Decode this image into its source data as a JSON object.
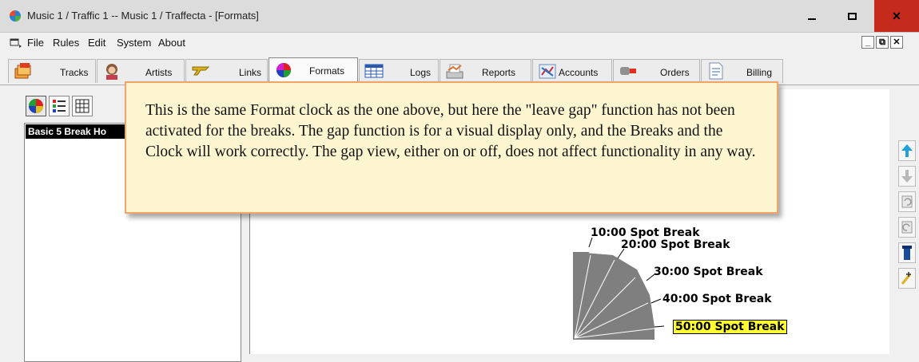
{
  "window": {
    "title": "Music 1 / Traffic 1 -- Music 1 / Traffecta - [Formats]",
    "icon": "app-globe-icon"
  },
  "menu": {
    "items": [
      "File",
      "Rules",
      "Edit",
      "System",
      "About"
    ]
  },
  "toolbar": {
    "tabs": [
      {
        "label": "Tracks",
        "icon": "tracks-icon",
        "active": false
      },
      {
        "label": "Artists",
        "icon": "artists-icon",
        "active": false
      },
      {
        "label": "Links",
        "icon": "links-icon",
        "active": false
      },
      {
        "label": "Formats",
        "icon": "formats-clock-icon",
        "active": true
      },
      {
        "label": "Logs",
        "icon": "logs-icon",
        "active": false
      },
      {
        "label": "Reports",
        "icon": "reports-icon",
        "active": false
      },
      {
        "label": "Accounts",
        "icon": "accounts-icon",
        "active": false
      },
      {
        "label": "Orders",
        "icon": "orders-icon",
        "active": false
      },
      {
        "label": "Billing",
        "icon": "billing-icon",
        "active": false
      }
    ]
  },
  "left_panel": {
    "view_buttons": [
      "clock-view-icon",
      "list-view-icon",
      "grid-view-icon"
    ],
    "formats": [
      "Basic 5 Break Ho"
    ]
  },
  "callout": {
    "text": "This is the same Format clock as the one above, but here the \"leave gap\" function has not been activated for the breaks. The gap function is for a visual display only, and the Breaks and the Clock will work correctly. The gap view, either on or off, does not affect functionality in any way."
  },
  "clock": {
    "breaks": [
      {
        "label": "10:00 Spot Break",
        "selected": false
      },
      {
        "label": "20:00 Spot Break",
        "selected": false
      },
      {
        "label": "30:00 Spot Break",
        "selected": false
      },
      {
        "label": "40:00 Spot Break",
        "selected": false
      },
      {
        "label": "50:00 Spot Break",
        "selected": true
      }
    ],
    "segment_color": "#7f7f7f",
    "highlight_color": "#ffff33"
  },
  "right_toolbar": {
    "buttons": [
      "move-up-icon",
      "move-down-icon",
      "undo-icon",
      "redo-icon",
      "insert-icon",
      "add-new-icon"
    ]
  },
  "colors": {
    "close_button": "#c42b1c",
    "callout_border": "#f0a468",
    "callout_bg": "#fdf5cf"
  }
}
